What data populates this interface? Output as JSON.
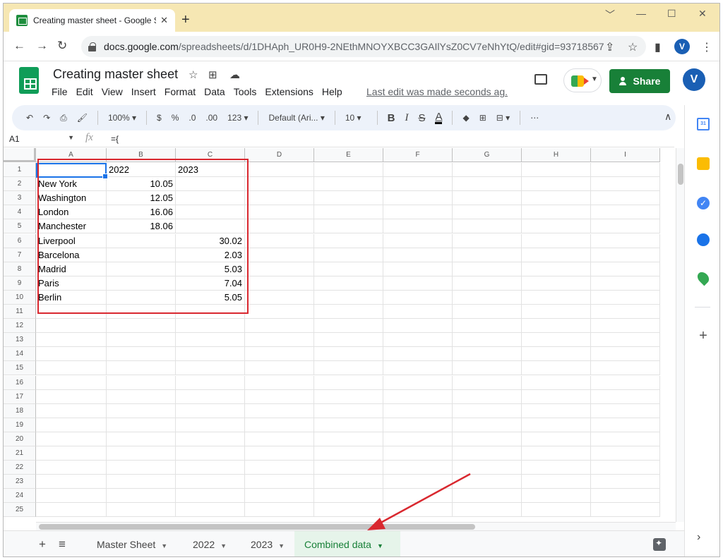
{
  "browser": {
    "tab_title": "Creating master sheet - Google S",
    "close_glyph": "✕",
    "new_tab_glyph": "+",
    "window_controls": [
      "﹀",
      "—",
      "☐",
      "✕"
    ],
    "nav": {
      "back": "←",
      "forward": "→",
      "reload": "↻"
    },
    "url_host": "docs.google.com",
    "url_path": "/spreadsheets/d/1DHAph_UR0H9-2NEthMNOYXBCC3GAIlYsZ0CV7eNhYtQ/edit#gid=93718567",
    "profile_initial": "V",
    "icons": {
      "share": "⇪",
      "star": "☆",
      "sidepanel": "▮",
      "menu": "⋮"
    }
  },
  "doc": {
    "title": "Creating master sheet",
    "title_icons": {
      "star": "☆",
      "move": "⊞",
      "cloud": "☁"
    },
    "menu": [
      "File",
      "Edit",
      "View",
      "Insert",
      "Format",
      "Data",
      "Tools",
      "Extensions",
      "Help"
    ],
    "last_edit": "Last edit was made seconds ag...",
    "share_label": "Share",
    "avatar": "V"
  },
  "toolbar": {
    "undo": "↶",
    "redo": "↷",
    "print": "⎙",
    "paint": "🖌",
    "zoom": "100% ▾",
    "currency": "$",
    "percent": "%",
    "dec_less": ".0",
    "dec_more": ".00",
    "format_num": "123 ▾",
    "font": "Default (Ari... ▾",
    "font_size": "10 ▾",
    "bold": "B",
    "italic": "I",
    "strike": "S",
    "text_color": "A",
    "fill": "◆",
    "borders": "⊞",
    "merge": "⊟ ▾",
    "more": "⋯",
    "collapse": "∧"
  },
  "formula_bar": {
    "name_box": "A1",
    "name_box_dd": "▼",
    "fx": "fx",
    "value": "={"
  },
  "columns": [
    "A",
    "B",
    "C",
    "D",
    "E",
    "F",
    "G",
    "H",
    "I"
  ],
  "rows": [
    [
      "",
      "2022",
      "2023"
    ],
    [
      "New York",
      "10.05",
      ""
    ],
    [
      "Washington",
      "12.05",
      ""
    ],
    [
      "London",
      "16.06",
      ""
    ],
    [
      "Manchester",
      "18.06",
      ""
    ],
    [
      "Liverpool",
      "",
      "30.02"
    ],
    [
      "Barcelona",
      "",
      "2.03"
    ],
    [
      "Madrid",
      "",
      "5.03"
    ],
    [
      "Paris",
      "",
      "7.04"
    ],
    [
      "Berlin",
      "",
      "5.05"
    ]
  ],
  "row_numbers": [
    "1",
    "2",
    "3",
    "4",
    "5",
    "6",
    "7",
    "8",
    "9",
    "10",
    "11",
    "12",
    "13",
    "14",
    "15",
    "16",
    "17",
    "18",
    "19",
    "20",
    "21",
    "22",
    "23",
    "24",
    "25"
  ],
  "sheets": [
    {
      "name": "Master Sheet",
      "active": false
    },
    {
      "name": "2022",
      "active": false
    },
    {
      "name": "2023",
      "active": false
    },
    {
      "name": "Combined data",
      "active": true
    }
  ],
  "sheet_caret": "▼",
  "sheetbar_icons": {
    "add": "+",
    "list": "≡"
  },
  "side_panel": {
    "calendar_label": "31",
    "add": "+",
    "expand": "›"
  },
  "annotation_color": "#d9282f"
}
